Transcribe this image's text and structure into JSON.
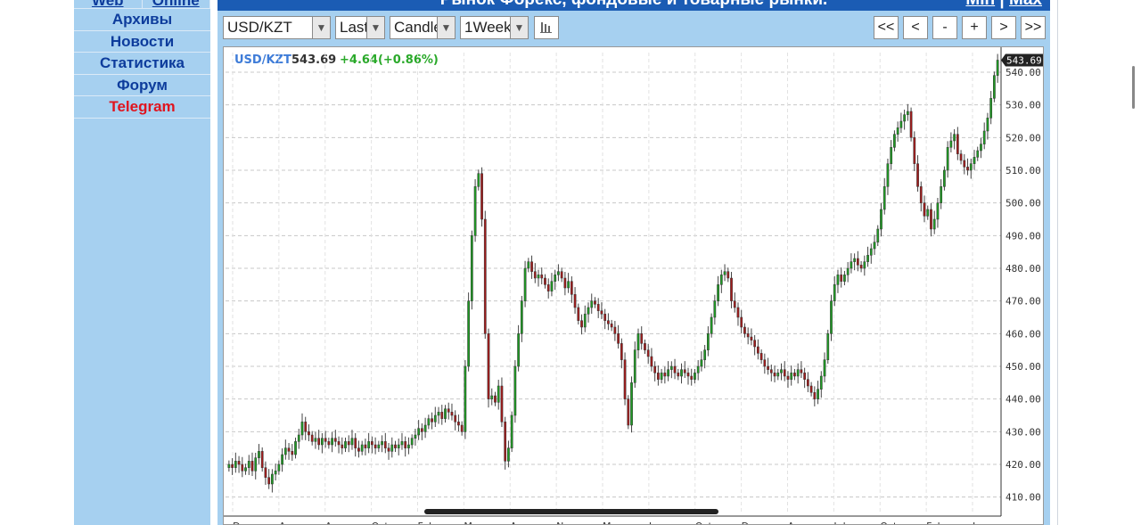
{
  "sidebar": {
    "top_tabs": [
      "Web",
      "Online"
    ],
    "items": [
      {
        "label": "Архивы"
      },
      {
        "label": "Новости"
      },
      {
        "label": "Статистика"
      },
      {
        "label": "Форум"
      },
      {
        "label": "Telegram"
      }
    ]
  },
  "header": {
    "title": "Рынок Форекс, фондовые и товарные рынки.",
    "zoom_min": "Min",
    "zoom_sep": "|",
    "zoom_max": "Max"
  },
  "toolbar": {
    "symbol": "USD/KZT",
    "price_type": "Last",
    "chart_style": "Candle",
    "period": "1Week",
    "nav_first": "<<",
    "nav_prev": "<",
    "zoom_out": "-",
    "zoom_in": "+",
    "nav_next": ">",
    "nav_last": ">>"
  },
  "colors": {
    "up": "#1f9a24",
    "down": "#a01c1c",
    "panel": "#a6d0f0",
    "header": "#1b5cb4",
    "symbol_label": "#3e7cd8",
    "change": "#2aa92a"
  },
  "chart_data": {
    "type": "candlestick",
    "symbol_label": "USD/KZT",
    "last_price": "543.69",
    "change": "+4.64(+0.86%)",
    "last_tag": "543.69",
    "ylim": [
      405,
      546
    ],
    "y_ticks": [
      "410.00",
      "420.00",
      "430.00",
      "440.00",
      "450.00",
      "460.00",
      "470.00",
      "480.00",
      "490.00",
      "500.00",
      "510.00",
      "520.00",
      "530.00",
      "540.00"
    ],
    "x_ticks": [
      "Dec",
      "Apr",
      "Aug",
      "Oct",
      "Feb",
      "May",
      "Aug",
      "Nov",
      "Mar",
      "Jun",
      "Oct",
      "Dec",
      "Apr",
      "Jul",
      "Oct",
      "Feb",
      "Jun"
    ],
    "close": [
      420,
      419,
      421,
      420,
      418,
      419,
      421,
      418,
      422,
      424,
      419,
      416,
      414,
      417,
      418,
      420,
      423,
      425,
      424,
      423,
      427,
      429,
      433,
      430,
      429,
      427,
      428,
      426,
      428,
      427,
      426,
      428,
      427,
      426,
      425,
      427,
      426,
      428,
      425,
      424,
      426,
      425,
      427,
      426,
      425,
      426,
      427,
      425,
      424,
      426,
      425,
      426,
      427,
      425,
      426,
      428,
      429,
      431,
      430,
      432,
      434,
      433,
      435,
      436,
      434,
      437,
      436,
      435,
      433,
      432,
      430,
      450,
      470,
      490,
      505,
      509,
      495,
      460,
      440,
      441,
      439,
      444,
      433,
      421,
      425,
      435,
      450,
      460,
      470,
      480,
      482,
      479,
      477,
      478,
      477,
      475,
      473,
      476,
      478,
      479,
      477,
      474,
      476,
      472,
      468,
      464,
      462,
      466,
      468,
      470,
      469,
      467,
      466,
      464,
      463,
      462,
      460,
      457,
      452,
      440,
      432,
      445,
      455,
      460,
      457,
      455,
      453,
      450,
      448,
      446,
      448,
      447,
      449,
      450,
      448,
      447,
      449,
      448,
      447,
      446,
      448,
      450,
      452,
      455,
      460,
      465,
      470,
      475,
      478,
      479,
      477,
      470,
      468,
      465,
      462,
      460,
      459,
      458,
      456,
      454,
      452,
      450,
      449,
      448,
      447,
      448,
      449,
      447,
      446,
      448,
      447,
      449,
      448,
      446,
      444,
      442,
      440,
      443,
      447,
      452,
      460,
      470,
      475,
      478,
      476,
      478,
      480,
      482,
      483,
      481,
      480,
      482,
      484,
      486,
      488,
      492,
      498,
      505,
      512,
      517,
      521,
      523,
      525,
      527,
      528,
      520,
      512,
      505,
      500,
      496,
      498,
      492,
      495,
      500,
      505,
      510,
      517,
      519,
      521,
      515,
      513,
      511,
      510,
      512,
      514,
      516,
      518,
      522,
      526,
      532,
      539,
      543.69
    ],
    "last_label_value": "543.69"
  }
}
